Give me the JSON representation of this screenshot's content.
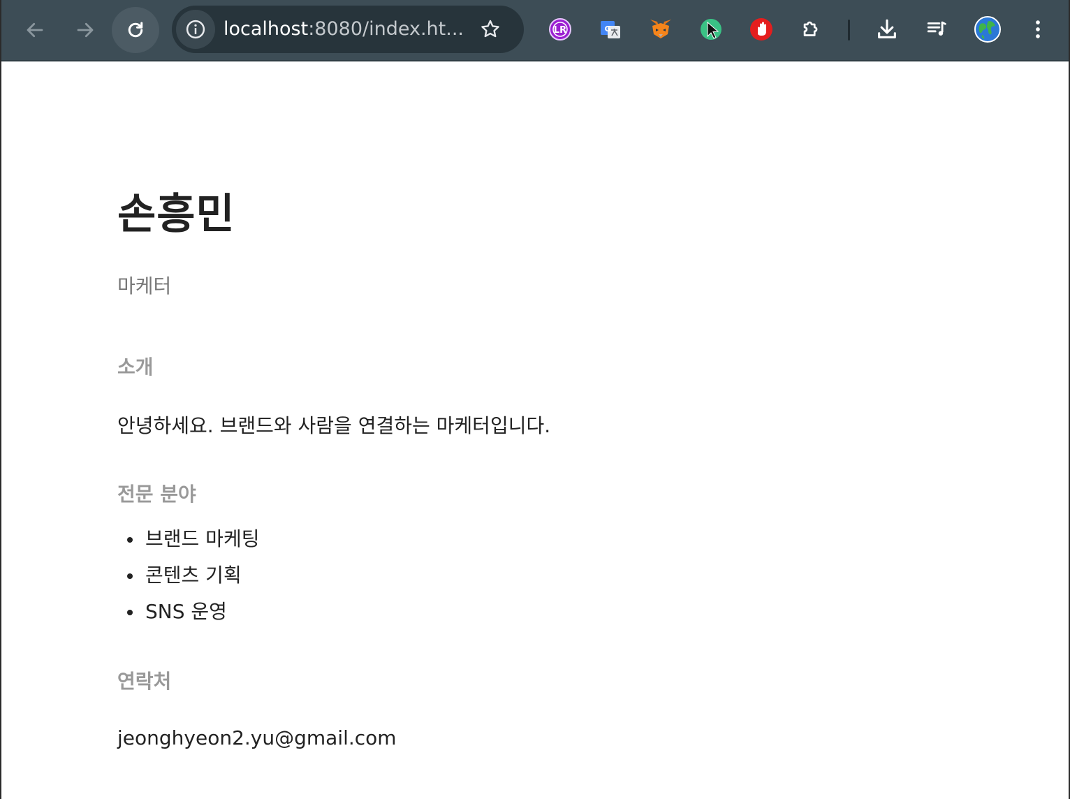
{
  "browser": {
    "url_host": "localhost",
    "url_path": ":8080/index.ht...",
    "colors": {
      "toolbar": "#3d4d56",
      "omnibox": "#27343b"
    },
    "extensions": [
      "lr-extension-icon",
      "google-translate-icon",
      "metamask-fox-icon",
      "cursor-extension-icon",
      "stop-hand-icon",
      "puzzle-extensions-icon"
    ],
    "actions": [
      "download-icon",
      "media-queue-icon",
      "globe-icon",
      "more-menu-icon"
    ]
  },
  "profile": {
    "name": "손흥민",
    "role": "마케터",
    "intro_title": "소개",
    "intro_text": "안녕하세요. 브랜드와 사람을 연결하는 마케터입니다.",
    "skills_title": "전문 분야",
    "skills": [
      "브랜드 마케팅",
      "콘텐츠 기획",
      "SNS 운영"
    ],
    "contact_title": "연락처",
    "email": "jeonghyeon2.yu@gmail.com"
  }
}
